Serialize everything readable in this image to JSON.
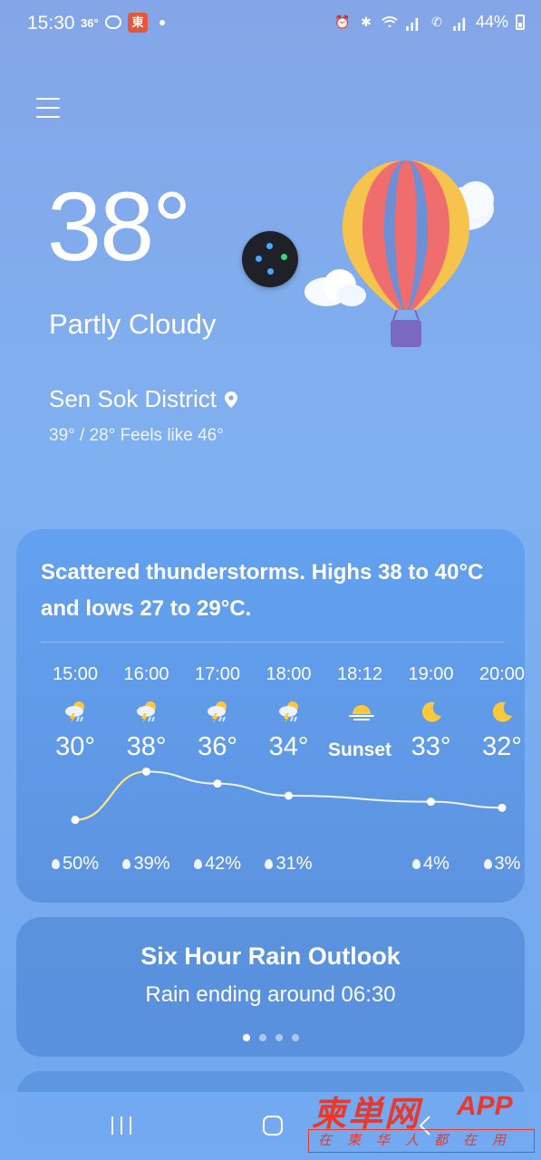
{
  "status_bar": {
    "time": "15:30",
    "temp": "36°",
    "app_icon_text": "東",
    "battery": "44%"
  },
  "current": {
    "temperature": "38°",
    "condition": "Partly Cloudy",
    "location": "Sen Sok District",
    "range": "39° / 28° Feels like 46°"
  },
  "forecast": {
    "summary": "Scattered thunderstorms. Highs 38 to 40°C and lows 27 to 29°C.",
    "hours": [
      {
        "time": "15:00",
        "icon": "thunderstorm-icon",
        "temp": "30°",
        "precip": "50%"
      },
      {
        "time": "16:00",
        "icon": "thunderstorm-icon",
        "temp": "38°",
        "precip": "39%"
      },
      {
        "time": "17:00",
        "icon": "thunderstorm-icon",
        "temp": "36°",
        "precip": "42%"
      },
      {
        "time": "18:00",
        "icon": "thunderstorm-icon",
        "temp": "34°",
        "precip": "31%"
      },
      {
        "time": "18:12",
        "icon": "sunset-icon",
        "temp": "Sunset",
        "precip": ""
      },
      {
        "time": "19:00",
        "icon": "moon-icon",
        "temp": "33°",
        "precip": "4%"
      },
      {
        "time": "20:00",
        "icon": "moon-icon",
        "temp": "32°",
        "precip": "3%"
      }
    ],
    "chart_values": [
      30,
      38,
      36,
      34,
      null,
      33,
      32
    ]
  },
  "rain_outlook": {
    "title": "Six Hour Rain Outlook",
    "subtitle": "Rain ending around 06:30",
    "pages": 4,
    "active_page": 0
  },
  "watermark": {
    "logo": "柬単网",
    "app": "APP",
    "slogan": "在柬华人都在用"
  },
  "colors": {
    "accent_line": "#ffe57a",
    "card": "#5a91e1"
  }
}
